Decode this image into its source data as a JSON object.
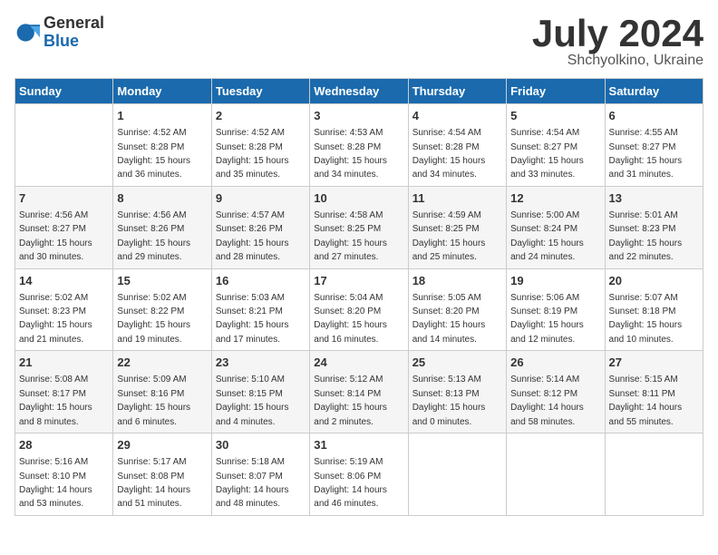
{
  "logo": {
    "general": "General",
    "blue": "Blue"
  },
  "header": {
    "title": "July 2024",
    "subtitle": "Shchyolkino, Ukraine"
  },
  "days_of_week": [
    "Sunday",
    "Monday",
    "Tuesday",
    "Wednesday",
    "Thursday",
    "Friday",
    "Saturday"
  ],
  "weeks": [
    [
      null,
      {
        "day": 1,
        "sunrise": "4:52 AM",
        "sunset": "8:28 PM",
        "daylight": "15 hours and 36 minutes."
      },
      {
        "day": 2,
        "sunrise": "4:52 AM",
        "sunset": "8:28 PM",
        "daylight": "15 hours and 35 minutes."
      },
      {
        "day": 3,
        "sunrise": "4:53 AM",
        "sunset": "8:28 PM",
        "daylight": "15 hours and 34 minutes."
      },
      {
        "day": 4,
        "sunrise": "4:54 AM",
        "sunset": "8:28 PM",
        "daylight": "15 hours and 34 minutes."
      },
      {
        "day": 5,
        "sunrise": "4:54 AM",
        "sunset": "8:27 PM",
        "daylight": "15 hours and 33 minutes."
      },
      {
        "day": 6,
        "sunrise": "4:55 AM",
        "sunset": "8:27 PM",
        "daylight": "15 hours and 31 minutes."
      }
    ],
    [
      {
        "day": 7,
        "sunrise": "4:56 AM",
        "sunset": "8:27 PM",
        "daylight": "15 hours and 30 minutes."
      },
      {
        "day": 8,
        "sunrise": "4:56 AM",
        "sunset": "8:26 PM",
        "daylight": "15 hours and 29 minutes."
      },
      {
        "day": 9,
        "sunrise": "4:57 AM",
        "sunset": "8:26 PM",
        "daylight": "15 hours and 28 minutes."
      },
      {
        "day": 10,
        "sunrise": "4:58 AM",
        "sunset": "8:25 PM",
        "daylight": "15 hours and 27 minutes."
      },
      {
        "day": 11,
        "sunrise": "4:59 AM",
        "sunset": "8:25 PM",
        "daylight": "15 hours and 25 minutes."
      },
      {
        "day": 12,
        "sunrise": "5:00 AM",
        "sunset": "8:24 PM",
        "daylight": "15 hours and 24 minutes."
      },
      {
        "day": 13,
        "sunrise": "5:01 AM",
        "sunset": "8:23 PM",
        "daylight": "15 hours and 22 minutes."
      }
    ],
    [
      {
        "day": 14,
        "sunrise": "5:02 AM",
        "sunset": "8:23 PM",
        "daylight": "15 hours and 21 minutes."
      },
      {
        "day": 15,
        "sunrise": "5:02 AM",
        "sunset": "8:22 PM",
        "daylight": "15 hours and 19 minutes."
      },
      {
        "day": 16,
        "sunrise": "5:03 AM",
        "sunset": "8:21 PM",
        "daylight": "15 hours and 17 minutes."
      },
      {
        "day": 17,
        "sunrise": "5:04 AM",
        "sunset": "8:20 PM",
        "daylight": "15 hours and 16 minutes."
      },
      {
        "day": 18,
        "sunrise": "5:05 AM",
        "sunset": "8:20 PM",
        "daylight": "15 hours and 14 minutes."
      },
      {
        "day": 19,
        "sunrise": "5:06 AM",
        "sunset": "8:19 PM",
        "daylight": "15 hours and 12 minutes."
      },
      {
        "day": 20,
        "sunrise": "5:07 AM",
        "sunset": "8:18 PM",
        "daylight": "15 hours and 10 minutes."
      }
    ],
    [
      {
        "day": 21,
        "sunrise": "5:08 AM",
        "sunset": "8:17 PM",
        "daylight": "15 hours and 8 minutes."
      },
      {
        "day": 22,
        "sunrise": "5:09 AM",
        "sunset": "8:16 PM",
        "daylight": "15 hours and 6 minutes."
      },
      {
        "day": 23,
        "sunrise": "5:10 AM",
        "sunset": "8:15 PM",
        "daylight": "15 hours and 4 minutes."
      },
      {
        "day": 24,
        "sunrise": "5:12 AM",
        "sunset": "8:14 PM",
        "daylight": "15 hours and 2 minutes."
      },
      {
        "day": 25,
        "sunrise": "5:13 AM",
        "sunset": "8:13 PM",
        "daylight": "15 hours and 0 minutes."
      },
      {
        "day": 26,
        "sunrise": "5:14 AM",
        "sunset": "8:12 PM",
        "daylight": "14 hours and 58 minutes."
      },
      {
        "day": 27,
        "sunrise": "5:15 AM",
        "sunset": "8:11 PM",
        "daylight": "14 hours and 55 minutes."
      }
    ],
    [
      {
        "day": 28,
        "sunrise": "5:16 AM",
        "sunset": "8:10 PM",
        "daylight": "14 hours and 53 minutes."
      },
      {
        "day": 29,
        "sunrise": "5:17 AM",
        "sunset": "8:08 PM",
        "daylight": "14 hours and 51 minutes."
      },
      {
        "day": 30,
        "sunrise": "5:18 AM",
        "sunset": "8:07 PM",
        "daylight": "14 hours and 48 minutes."
      },
      {
        "day": 31,
        "sunrise": "5:19 AM",
        "sunset": "8:06 PM",
        "daylight": "14 hours and 46 minutes."
      },
      null,
      null,
      null
    ]
  ]
}
